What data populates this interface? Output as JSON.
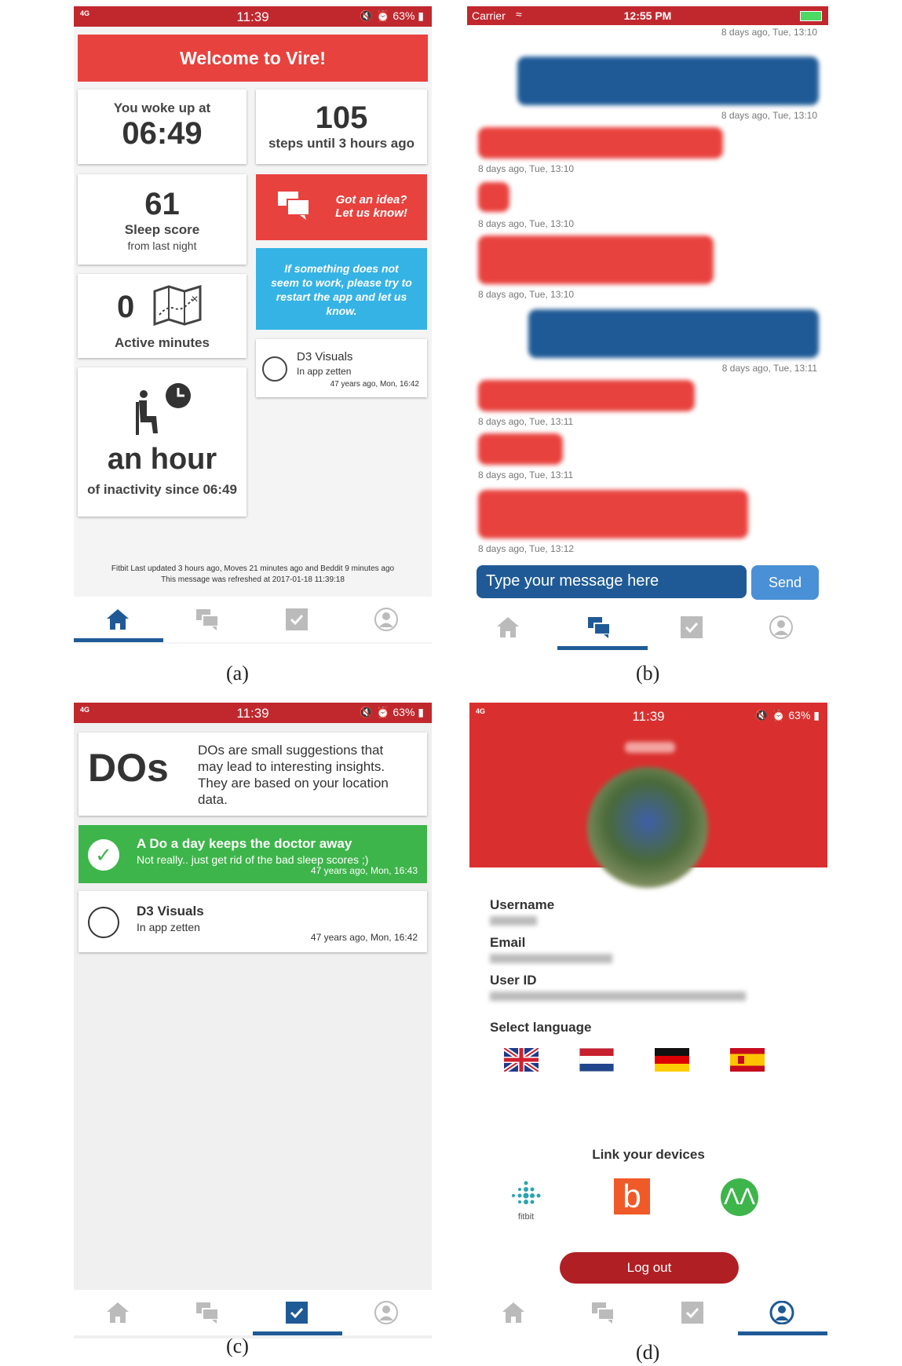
{
  "captions": [
    "(a)",
    "(b)",
    "(c)",
    "(d)"
  ],
  "status": {
    "network": "4G",
    "time": "11:39",
    "battery": "63%"
  },
  "status_ios": {
    "carrier": "Carrier",
    "time": "12:55 PM"
  },
  "screen_a": {
    "banner": "Welcome to Vire!",
    "woke_label": "You woke up at",
    "woke_time": "06:49",
    "steps_value": "105",
    "steps_label": "steps until 3 hours ago",
    "sleep_value": "61",
    "sleep_label": "Sleep score",
    "sleep_sub": "from last night",
    "idea_line1": "Got an idea?",
    "idea_line2": "Let us know!",
    "info_text": "If something does not seem to work, please try to restart the app and let us know.",
    "active_value": "0",
    "active_label": "Active minutes",
    "do_title": "D3 Visuals",
    "do_sub": "In app zetten",
    "do_time": "47 years ago, Mon, 16:42",
    "inactivity_value": "an hour",
    "inactivity_label": "of inactivity since 06:49",
    "footer_line1": "Fitbit Last updated 3 hours ago, Moves 21 minutes ago and Beddit 9 minutes ago",
    "footer_line2": "This message was refreshed at 2017-01-18 11:39:18"
  },
  "screen_b": {
    "timestamps": [
      "8 days ago, Tue, 13:10",
      "8 days ago, Tue, 13:10",
      "8 days ago, Tue, 13:10",
      "8 days ago, Tue, 13:10",
      "8 days ago, Tue, 13:10",
      "8 days ago, Tue, 13:11",
      "8 days ago, Tue, 13:11",
      "8 days ago, Tue, 13:11",
      "8 days ago, Tue, 13:12"
    ],
    "input_placeholder": "Type your message here",
    "send_label": "Send"
  },
  "screen_c": {
    "header_title": "DOs",
    "header_text": "DOs are small suggestions that may lead to interesting insights. They are based on your location data.",
    "done_title": "A Do a day keeps the doctor away",
    "done_sub": "Not really.. just get rid of the bad sleep scores ;)",
    "done_time": "47 years ago, Mon, 16:43",
    "todo_title": "D3 Visuals",
    "todo_sub": "In app zetten",
    "todo_time": "47 years ago, Mon, 16:42"
  },
  "screen_d": {
    "username_label": "Username",
    "email_label": "Email",
    "userid_label": "User ID",
    "language_label": "Select language",
    "languages": [
      "uk-flag-icon",
      "netherlands-flag-icon",
      "germany-flag-icon",
      "spain-flag-icon"
    ],
    "devices_label": "Link your devices",
    "fitbit_label": "fitbit",
    "logout_label": "Log out"
  },
  "colors": {
    "red": "#e8423e",
    "dark_red": "#c0282e",
    "blue": "#1f5a96",
    "light_blue": "#35b3e5",
    "green": "#3db54a"
  }
}
